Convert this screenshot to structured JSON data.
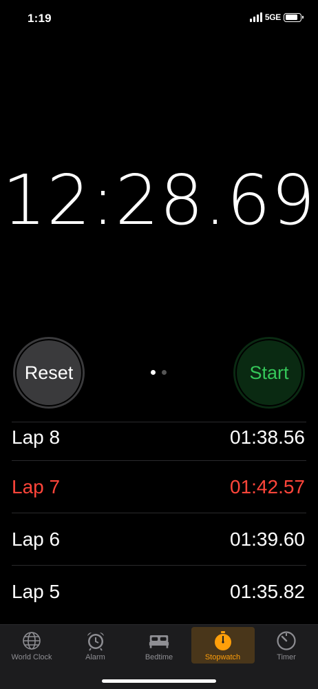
{
  "status": {
    "time": "1:19",
    "network": "5GE"
  },
  "stopwatch": {
    "time": "12:28.69"
  },
  "buttons": {
    "reset_label": "Reset",
    "start_label": "Start"
  },
  "laps": [
    {
      "label": "Lap 8",
      "time": "01:38.56",
      "status": "normal"
    },
    {
      "label": "Lap 7",
      "time": "01:42.57",
      "status": "slowest"
    },
    {
      "label": "Lap 6",
      "time": "01:39.60",
      "status": "normal"
    },
    {
      "label": "Lap 5",
      "time": "01:35.82",
      "status": "normal"
    }
  ],
  "tabs": [
    {
      "label": "World Clock",
      "icon": "globe-icon",
      "active": false
    },
    {
      "label": "Alarm",
      "icon": "alarm-clock-icon",
      "active": false
    },
    {
      "label": "Bedtime",
      "icon": "bed-icon",
      "active": false
    },
    {
      "label": "Stopwatch",
      "icon": "stopwatch-icon",
      "active": true
    },
    {
      "label": "Timer",
      "icon": "timer-icon",
      "active": false
    }
  ],
  "colors": {
    "accent": "#ff9f0a",
    "start_green": "#35c759",
    "slowest_red": "#ff453a",
    "reset_gray": "#3a3a3c"
  }
}
